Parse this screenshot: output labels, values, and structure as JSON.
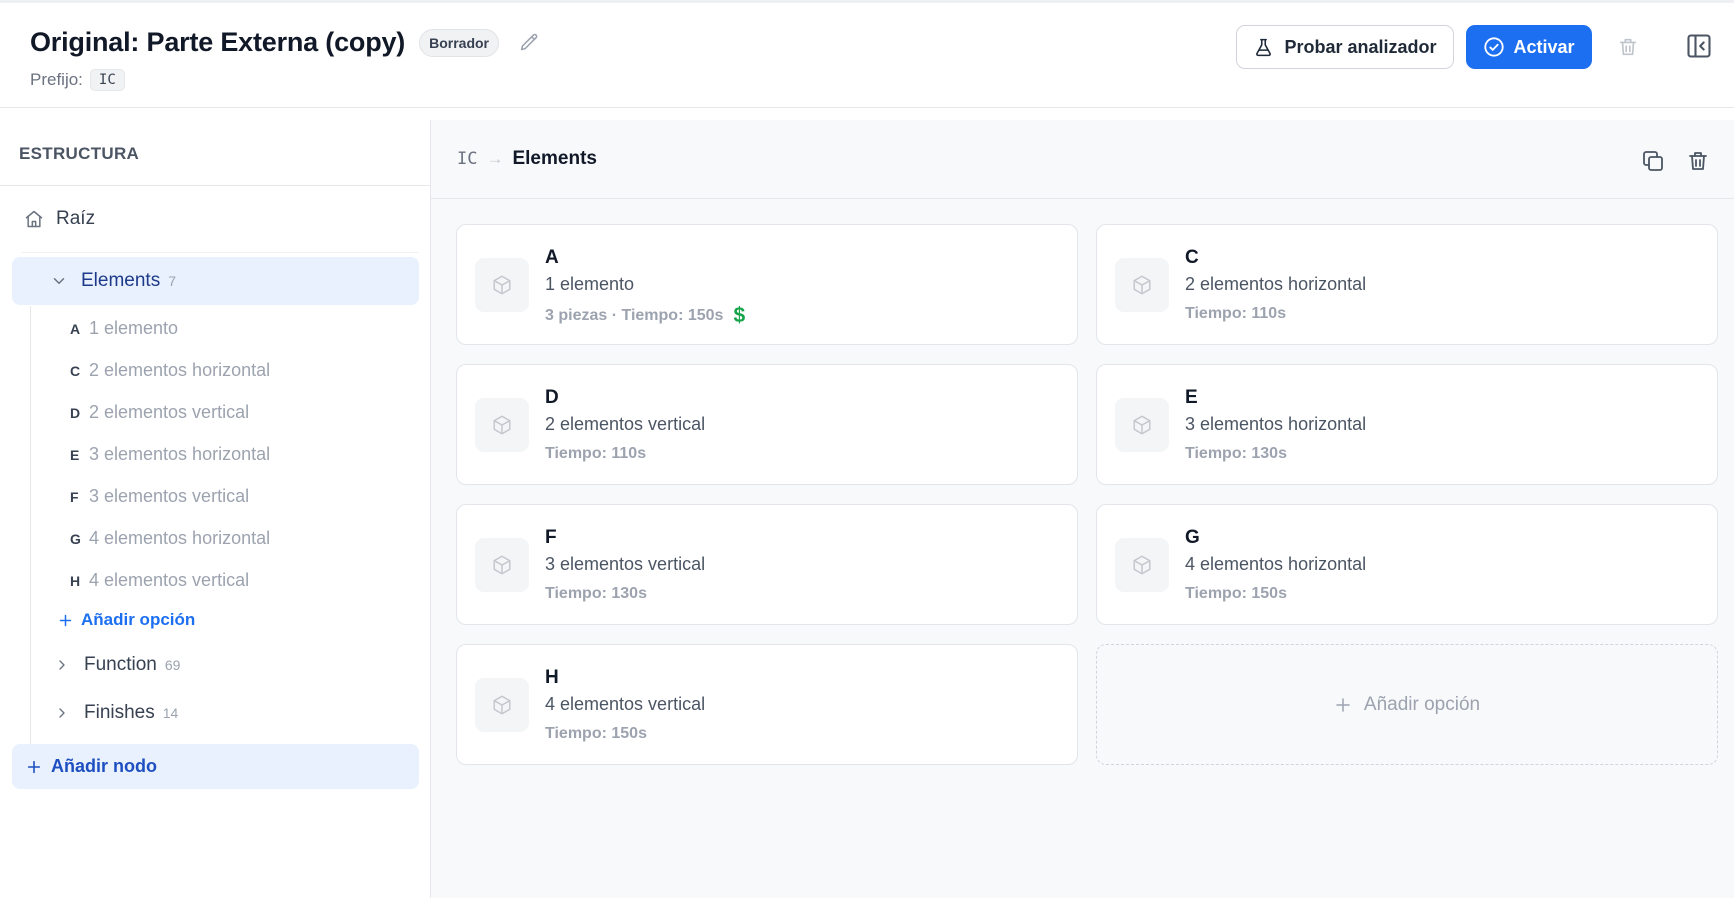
{
  "header": {
    "title": "Original: Parte Externa (copy)",
    "status_badge": "Borrador",
    "prefix_label": "Prefijo:",
    "prefix_value": "IC",
    "test_button": "Probar analizador",
    "activate_button": "Activar"
  },
  "sidebar": {
    "title": "ESTRUCTURA",
    "root_label": "Raíz",
    "nodes": [
      {
        "label": "Elements",
        "count": "7",
        "children": [
          {
            "letter": "A",
            "desc": "1 elemento"
          },
          {
            "letter": "C",
            "desc": "2 elementos horizontal"
          },
          {
            "letter": "D",
            "desc": "2 elementos vertical"
          },
          {
            "letter": "E",
            "desc": "3 elementos horizontal"
          },
          {
            "letter": "F",
            "desc": "3 elementos vertical"
          },
          {
            "letter": "G",
            "desc": "4 elementos horizontal"
          },
          {
            "letter": "H",
            "desc": "4 elementos vertical"
          }
        ],
        "add_option": "Añadir opción"
      },
      {
        "label": "Function",
        "count": "69"
      },
      {
        "label": "Finishes",
        "count": "14"
      }
    ],
    "add_node": "Añadir nodo"
  },
  "main": {
    "breadcrumb_code": "IC",
    "breadcrumb_arrow": "→",
    "breadcrumb_current": "Elements",
    "cards": [
      {
        "letter": "A",
        "desc": "1 elemento",
        "meta": "3 piezas · Tiempo: 150s",
        "price_icon": "$"
      },
      {
        "letter": "C",
        "desc": "2 elementos horizontal",
        "meta": "Tiempo: 110s"
      },
      {
        "letter": "D",
        "desc": "2 elementos vertical",
        "meta": "Tiempo: 110s"
      },
      {
        "letter": "E",
        "desc": "3 elementos horizontal",
        "meta": "Tiempo: 130s"
      },
      {
        "letter": "F",
        "desc": "3 elementos vertical",
        "meta": "Tiempo: 130s"
      },
      {
        "letter": "G",
        "desc": "4 elementos horizontal",
        "meta": "Tiempo: 150s"
      },
      {
        "letter": "H",
        "desc": "4 elementos vertical",
        "meta": "Tiempo: 150s"
      }
    ],
    "add_option": "Añadir opción"
  },
  "colors": {
    "accent": "#1d6ff2",
    "selected_bg": "#e8f1fd",
    "price_green": "#16a34a"
  }
}
